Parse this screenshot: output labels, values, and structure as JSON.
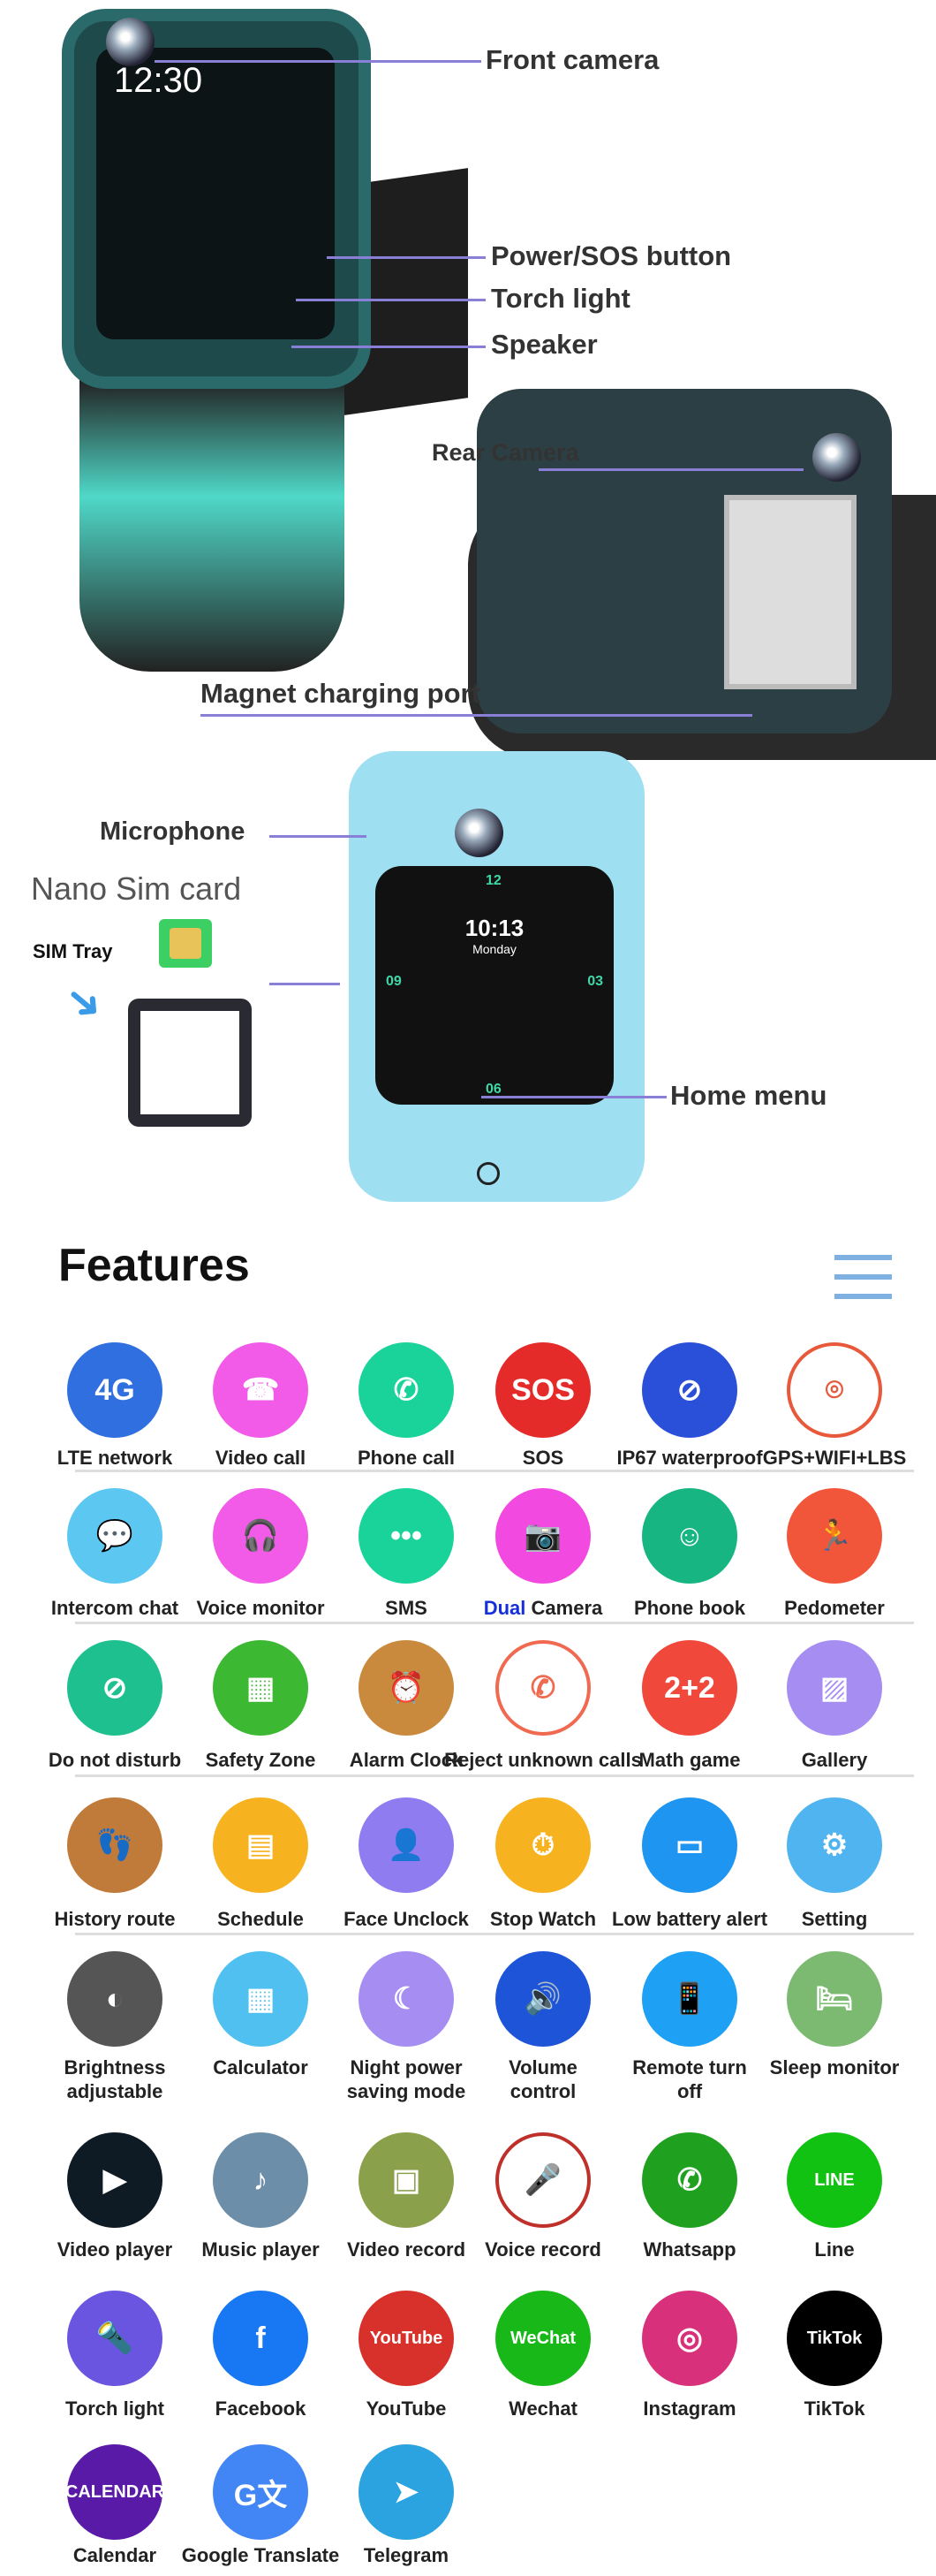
{
  "callouts": {
    "front_camera": "Front camera",
    "power_sos": "Power/SOS button",
    "torch": "Torch light",
    "speaker": "Speaker",
    "rear_camera": "Rear Camera",
    "magnet": "Magnet charging port",
    "microphone": "Microphone",
    "nano_sim": "Nano Sim card",
    "sim_tray": "SIM Tray",
    "home_menu": "Home menu"
  },
  "watch_screen": {
    "time": "12:30",
    "blue_time": "10:13",
    "blue_day": "Monday",
    "dial": [
      "12",
      "03",
      "06",
      "09"
    ]
  },
  "features": {
    "title": "Features",
    "menu_icon": "hamburger-menu-icon"
  },
  "rows": [
    [
      {
        "label": "LTE network",
        "icon": "4g-icon",
        "color": "#2f6fe0",
        "glyph": "4G"
      },
      {
        "label": "Video call",
        "icon": "video-call-icon",
        "color": "#f25ae8",
        "glyph": "☎"
      },
      {
        "label": "Phone call",
        "icon": "phone-icon",
        "color": "#19d39a",
        "glyph": "✆"
      },
      {
        "label": "SOS",
        "icon": "sos-icon",
        "color": "#e52a2a",
        "glyph": "SOS"
      },
      {
        "label": "IP67 waterproof",
        "icon": "waterproof-icon",
        "color": "#2a4fd8",
        "glyph": "⊘"
      },
      {
        "label": "GPS+WIFI+LBS",
        "icon": "location-pin-icon",
        "color": "#ffffff",
        "glyph": "⌾",
        "fg": "#e8583a"
      }
    ],
    [
      {
        "label": "Intercom chat",
        "icon": "chat-icon",
        "color": "#5cc8f2",
        "glyph": "💬"
      },
      {
        "label": "Voice monitor",
        "icon": "headphones-icon",
        "color": "#f25ae8",
        "glyph": "🎧"
      },
      {
        "label": "SMS",
        "icon": "sms-icon",
        "color": "#19d39a",
        "glyph": "•••"
      },
      {
        "label": "Camera",
        "prefix": "Dual",
        "icon": "camera-icon",
        "color": "#f24ae0",
        "glyph": "📷"
      },
      {
        "label": "Phone book",
        "icon": "contacts-icon",
        "color": "#17b582",
        "glyph": "☺"
      },
      {
        "label": "Pedometer",
        "icon": "runner-icon",
        "color": "#f2563a",
        "glyph": "🏃"
      }
    ],
    [
      {
        "label": "Do not disturb",
        "icon": "do-not-disturb-icon",
        "color": "#1fc08f",
        "glyph": "⊘"
      },
      {
        "label": "Safety Zone",
        "icon": "fence-icon",
        "color": "#3cb832",
        "glyph": "▦"
      },
      {
        "label": "Alarm Clock",
        "icon": "alarm-clock-icon",
        "color": "#c98a3e",
        "glyph": "⏰"
      },
      {
        "label": "Reject unknown calls",
        "icon": "reject-call-icon",
        "color": "#ffffff",
        "glyph": "✆",
        "fg": "#ef6a50"
      },
      {
        "label": "Math game",
        "icon": "math-board-icon",
        "color": "#f0483a",
        "glyph": "2+2"
      },
      {
        "label": "Gallery",
        "icon": "gallery-icon",
        "color": "#a58df2",
        "glyph": "▨"
      }
    ],
    [
      {
        "label": "History route",
        "icon": "footprints-icon",
        "color": "#c07a3a",
        "glyph": "👣"
      },
      {
        "label": "Schedule",
        "icon": "calendar-icon",
        "color": "#f7b21f",
        "glyph": "▤"
      },
      {
        "label": "Face Unclock",
        "icon": "face-scan-icon",
        "color": "#8f7cf0",
        "glyph": "👤"
      },
      {
        "label": "Stop Watch",
        "icon": "stopwatch-icon",
        "color": "#f7b21f",
        "glyph": "⏱"
      },
      {
        "label": "Low battery alert",
        "icon": "battery-icon",
        "color": "#1e95f0",
        "glyph": "▭"
      },
      {
        "label": "Setting",
        "icon": "gear-icon",
        "color": "#4fb4ef",
        "glyph": "⚙"
      }
    ],
    [
      {
        "label": "Brightness adjustable",
        "icon": "brightness-icon",
        "color": "#555555",
        "glyph": "◐"
      },
      {
        "label": "Calculator",
        "icon": "calculator-icon",
        "color": "#4fc0ef",
        "glyph": "▦"
      },
      {
        "label": "Night power saving mode",
        "icon": "moon-icon",
        "color": "#a58df2",
        "glyph": "☾"
      },
      {
        "label": "Volume control",
        "icon": "volume-icon",
        "color": "#1e55d8",
        "glyph": "🔊"
      },
      {
        "label": "Remote turn off",
        "icon": "remote-icon",
        "color": "#1ea0f5",
        "glyph": "📱"
      },
      {
        "label": "Sleep monitor",
        "icon": "bed-icon",
        "color": "#7cba72",
        "glyph": "🛏"
      }
    ],
    [
      {
        "label": "Video player",
        "icon": "play-icon",
        "color": "#0e1a24",
        "glyph": "▶"
      },
      {
        "label": "Music player",
        "icon": "music-note-icon",
        "color": "#6c8ea8",
        "glyph": "♪"
      },
      {
        "label": "Video record",
        "icon": "video-record-icon",
        "color": "#8aa04a",
        "glyph": "▣"
      },
      {
        "label": "Voice record",
        "icon": "microphone-icon",
        "color": "#ffffff",
        "glyph": "🎤",
        "fg": "#c0302a"
      },
      {
        "label": "Whatsapp",
        "icon": "whatsapp-icon",
        "color": "#1fa01f",
        "glyph": "✆"
      },
      {
        "label": "Line",
        "icon": "line-icon",
        "color": "#12c212",
        "glyph": "LINE"
      }
    ],
    [
      {
        "label": "Torch light",
        "icon": "flashlight-icon",
        "color": "#6a55e0",
        "glyph": "🔦"
      },
      {
        "label": "Facebook",
        "icon": "facebook-icon",
        "color": "#1877f2",
        "glyph": "f"
      },
      {
        "label": "YouTube",
        "icon": "youtube-icon",
        "color": "#d8302a",
        "glyph": "YouTube"
      },
      {
        "label": "Wechat",
        "icon": "wechat-icon",
        "color": "#18b818",
        "glyph": "WeChat"
      },
      {
        "label": "Instagram",
        "icon": "instagram-icon",
        "color": "#d8307a",
        "glyph": "◎"
      },
      {
        "label": "TikTok",
        "icon": "tiktok-icon",
        "color": "#000000",
        "glyph": "TikTok"
      }
    ],
    [
      {
        "label": "Calendar",
        "icon": "calendar-app-icon",
        "color": "#5a1aa8",
        "glyph": "CALENDAR"
      },
      {
        "label": "Google Translate",
        "icon": "google-translate-icon",
        "color": "#4285f4",
        "glyph": "G文"
      },
      {
        "label": "Telegram",
        "icon": "telegram-icon",
        "color": "#2aa3e0",
        "glyph": "➤"
      }
    ]
  ]
}
